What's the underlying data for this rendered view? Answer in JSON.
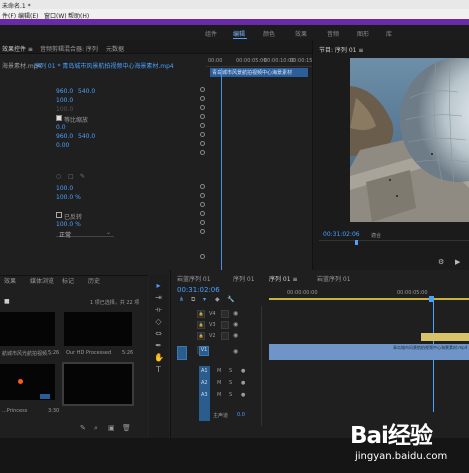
{
  "titlebar": {
    "title": "未命名.1 *",
    "menu": [
      "件(F)",
      "编辑(E)",
      "剪辑(C)",
      "",
      "窗口(W)",
      "帮助(H)"
    ]
  },
  "workspace_tabs": [
    "组件",
    "编辑",
    "颜色",
    "效果",
    "音频",
    "图形",
    "库"
  ],
  "effect_panel": {
    "tabs": [
      "效果控件 ≡",
      "音频剪辑混合器: 序列",
      "元数据"
    ],
    "source_label": "序列 01 * 青岛城市风景航拍视频中心海景素材.mp4",
    "source_prefix": "海景素材.mp4",
    "timecodes": [
      "00:00",
      "00:00:05:00",
      "00:00:10:00",
      "00:00:15:00"
    ],
    "clip_label": "青岛城市风景航拍视频中心海景素材",
    "values": {
      "pos_x": "960.0",
      "pos_y": "540.0",
      "scale_h": "100.0",
      "scale_w": "100.0",
      "uniform_scale": "等比缩放",
      "rotation": "0.0",
      "anchor_x": "960.0",
      "anchor_y": "540.0",
      "flicker": "0.00",
      "opacity": "100.0",
      "speed": "100.0 %",
      "reverse": "已反转",
      "speed2": "100.0 %",
      "blend": "正常"
    }
  },
  "program": {
    "title": "节目: 序列 01 ≡",
    "timecode": "00:31:02:06",
    "zoom": "適合"
  },
  "project": {
    "tabs": [
      "效果",
      "媒体浏览",
      "标记",
      "历史"
    ],
    "selected_count": "1 项已选择，共 22 项",
    "clip_names": [
      "航城市风光航拍视频...",
      "Our HD Processed",
      "...Princess"
    ],
    "clip_durations": [
      "5:26",
      "5:26",
      "5:26",
      "3:30"
    ],
    "folder": "■"
  },
  "timeline": {
    "tabs": [
      "岩蓝序列 01",
      "序列 01",
      "序列 01 ≡",
      "岩蓝序列 01"
    ],
    "timecode": "00:31:02:06",
    "ruler": [
      "00:00:00:00",
      "00:00:05:00",
      "00:00:10:00"
    ],
    "video_tracks": [
      "V4",
      "V3",
      "V2",
      "V1"
    ],
    "audio_tracks": [
      "A1",
      "A2",
      "A3"
    ],
    "master": "主声道",
    "master_val": "0.0",
    "clip_label": "青岛城市风景航拍视频中心海景素材.mp4"
  },
  "watermark": {
    "logo": "Bai经验",
    "url": "jingyan.baidu.com"
  }
}
